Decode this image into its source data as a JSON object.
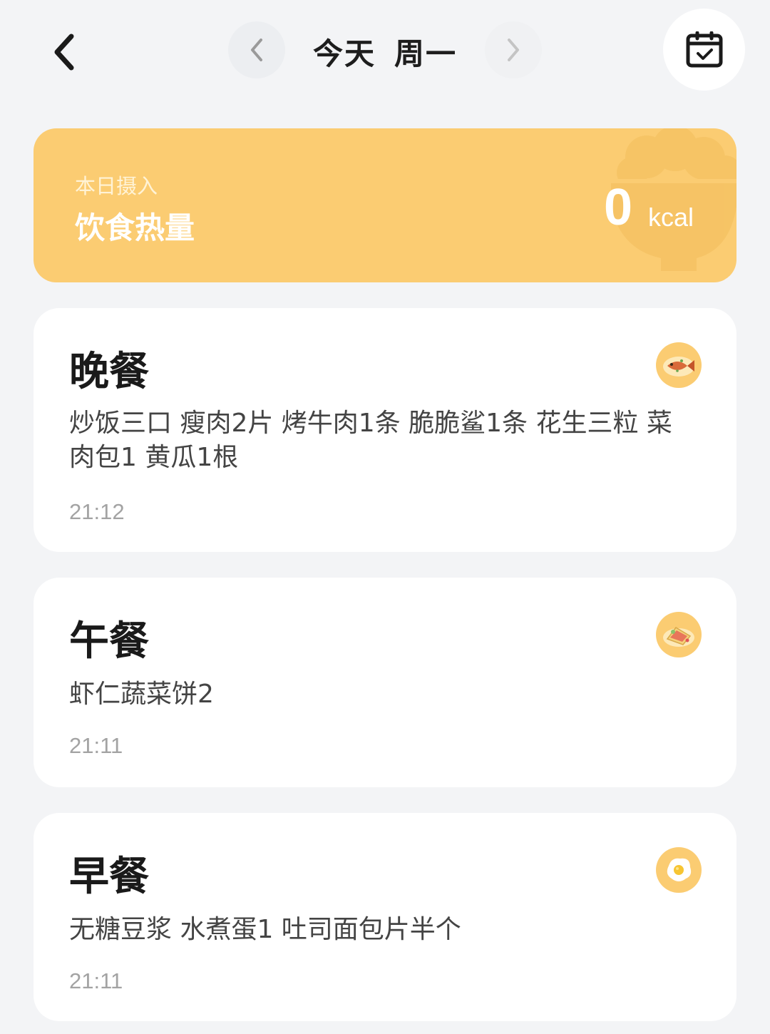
{
  "header": {
    "day": "今天",
    "weekday": "周一",
    "icons": {
      "back": "chevron-left-icon",
      "prev": "chevron-left-icon",
      "next": "chevron-right-icon",
      "calendar": "calendar-check-icon"
    }
  },
  "summary": {
    "subtitle": "本日摄入",
    "title": "饮食热量",
    "value": "0",
    "unit": "kcal",
    "background_icon": "rice-bowl-icon",
    "color": "#fbcc72"
  },
  "meals": [
    {
      "title": "晚餐",
      "items": "炒饭三口 瘦肉2片 烤牛肉1条 脆脆鲨1条 花生三粒 菜肉包1 黄瓜1根",
      "time": "21:12",
      "icon": "fish-dish-icon"
    },
    {
      "title": "午餐",
      "items": "虾仁蔬菜饼2",
      "time": "21:11",
      "icon": "sandwich-icon"
    },
    {
      "title": "早餐",
      "items": "无糖豆浆 水煮蛋1 吐司面包片半个",
      "time": "21:11",
      "icon": "fried-egg-icon"
    }
  ],
  "colors": {
    "accent": "#fbcc72",
    "background": "#f3f4f6",
    "card": "#ffffff"
  }
}
